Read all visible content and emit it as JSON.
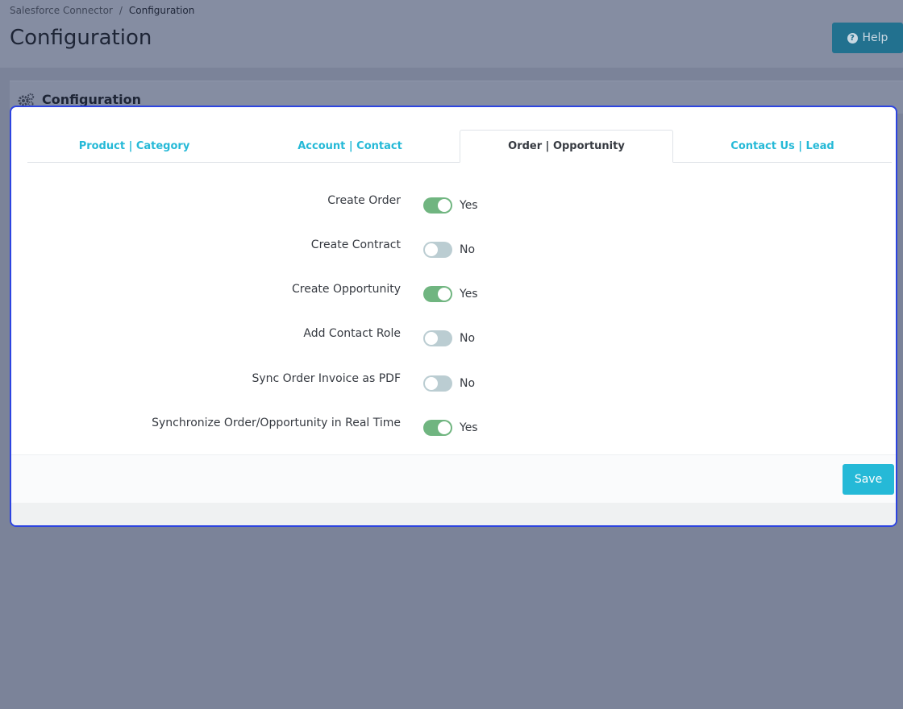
{
  "breadcrumb": {
    "parent": "Salesforce Connector",
    "separator": "/",
    "current": "Configuration"
  },
  "page": {
    "title": "Configuration"
  },
  "help_button": {
    "label": "Help",
    "icon": "question-circle-icon"
  },
  "panel": {
    "title": "Configuration",
    "icon": "gears-icon"
  },
  "tabs": [
    {
      "label": "Product | Category",
      "active": false
    },
    {
      "label": "Account | Contact",
      "active": false
    },
    {
      "label": "Order | Opportunity",
      "active": true
    },
    {
      "label": "Contact Us | Lead",
      "active": false
    }
  ],
  "settings": [
    {
      "label": "Create Order",
      "value": true,
      "state_text": "Yes"
    },
    {
      "label": "Create Contract",
      "value": false,
      "state_text": "No"
    },
    {
      "label": "Create Opportunity",
      "value": true,
      "state_text": "Yes"
    },
    {
      "label": "Add Contact Role",
      "value": false,
      "state_text": "No"
    },
    {
      "label": "Sync Order Invoice as PDF",
      "value": false,
      "state_text": "No"
    },
    {
      "label": "Synchronize Order/Opportunity in Real Time",
      "value": true,
      "state_text": "Yes"
    }
  ],
  "footer": {
    "save_label": "Save"
  },
  "colors": {
    "accent": "#25b9d7",
    "switch_on": "#70b580",
    "switch_off": "#bbcdd2",
    "highlight_border": "#2d44e0"
  }
}
